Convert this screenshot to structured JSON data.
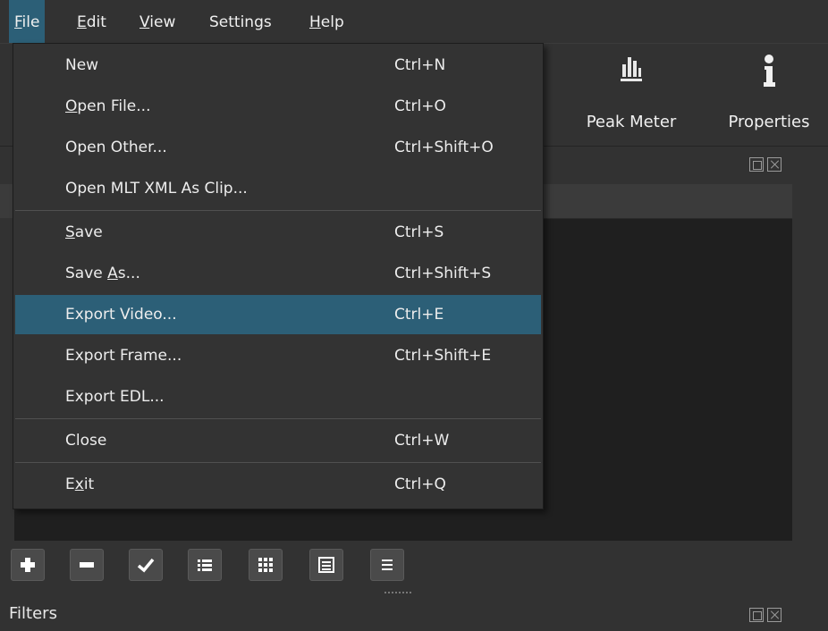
{
  "menubar": {
    "items": [
      {
        "pre": "",
        "ul": "F",
        "post": "ile"
      },
      {
        "pre": "",
        "ul": "E",
        "post": "dit"
      },
      {
        "pre": "",
        "ul": "V",
        "post": "iew"
      },
      {
        "pre": "Settings",
        "ul": "",
        "post": ""
      },
      {
        "pre": "",
        "ul": "H",
        "post": "elp"
      }
    ]
  },
  "toolbar": {
    "peak_meter": "Peak Meter",
    "properties": "Properties"
  },
  "file_menu": {
    "items": [
      {
        "pre": "New",
        "ul": "",
        "post": "",
        "shortcut": "Ctrl+N"
      },
      {
        "pre": "",
        "ul": "O",
        "post": "pen File...",
        "shortcut": "Ctrl+O"
      },
      {
        "pre": "Open Other...",
        "ul": "",
        "post": "",
        "shortcut": "Ctrl+Shift+O"
      },
      {
        "pre": "Open MLT XML As Clip...",
        "ul": "",
        "post": "",
        "shortcut": ""
      },
      {
        "pre": "",
        "ul": "S",
        "post": "ave",
        "shortcut": "Ctrl+S"
      },
      {
        "pre": "Save ",
        "ul": "A",
        "post": "s...",
        "shortcut": "Ctrl+Shift+S"
      },
      {
        "pre": "Export Video...",
        "ul": "",
        "post": "",
        "shortcut": "Ctrl+E"
      },
      {
        "pre": "Export Frame...",
        "ul": "",
        "post": "",
        "shortcut": "Ctrl+Shift+E"
      },
      {
        "pre": "Export EDL...",
        "ul": "",
        "post": "",
        "shortcut": ""
      },
      {
        "pre": "Close",
        "ul": "",
        "post": "",
        "shortcut": "Ctrl+W"
      },
      {
        "pre": "E",
        "ul": "x",
        "post": "it",
        "shortcut": "Ctrl+Q"
      }
    ],
    "highlighted_item": "Export Video..."
  },
  "panels": {
    "filters_title": "Filters"
  },
  "colors": {
    "background": "#323232",
    "highlight": "#2c5f77",
    "panel_dark": "#1f1f1f"
  },
  "icons": [
    "peak-meter-icon",
    "info-icon",
    "float-icon",
    "close-icon",
    "plus-icon",
    "minus-icon",
    "check-icon",
    "list-view-icon",
    "icon-view-icon",
    "tile-view-icon",
    "menu-icon"
  ]
}
